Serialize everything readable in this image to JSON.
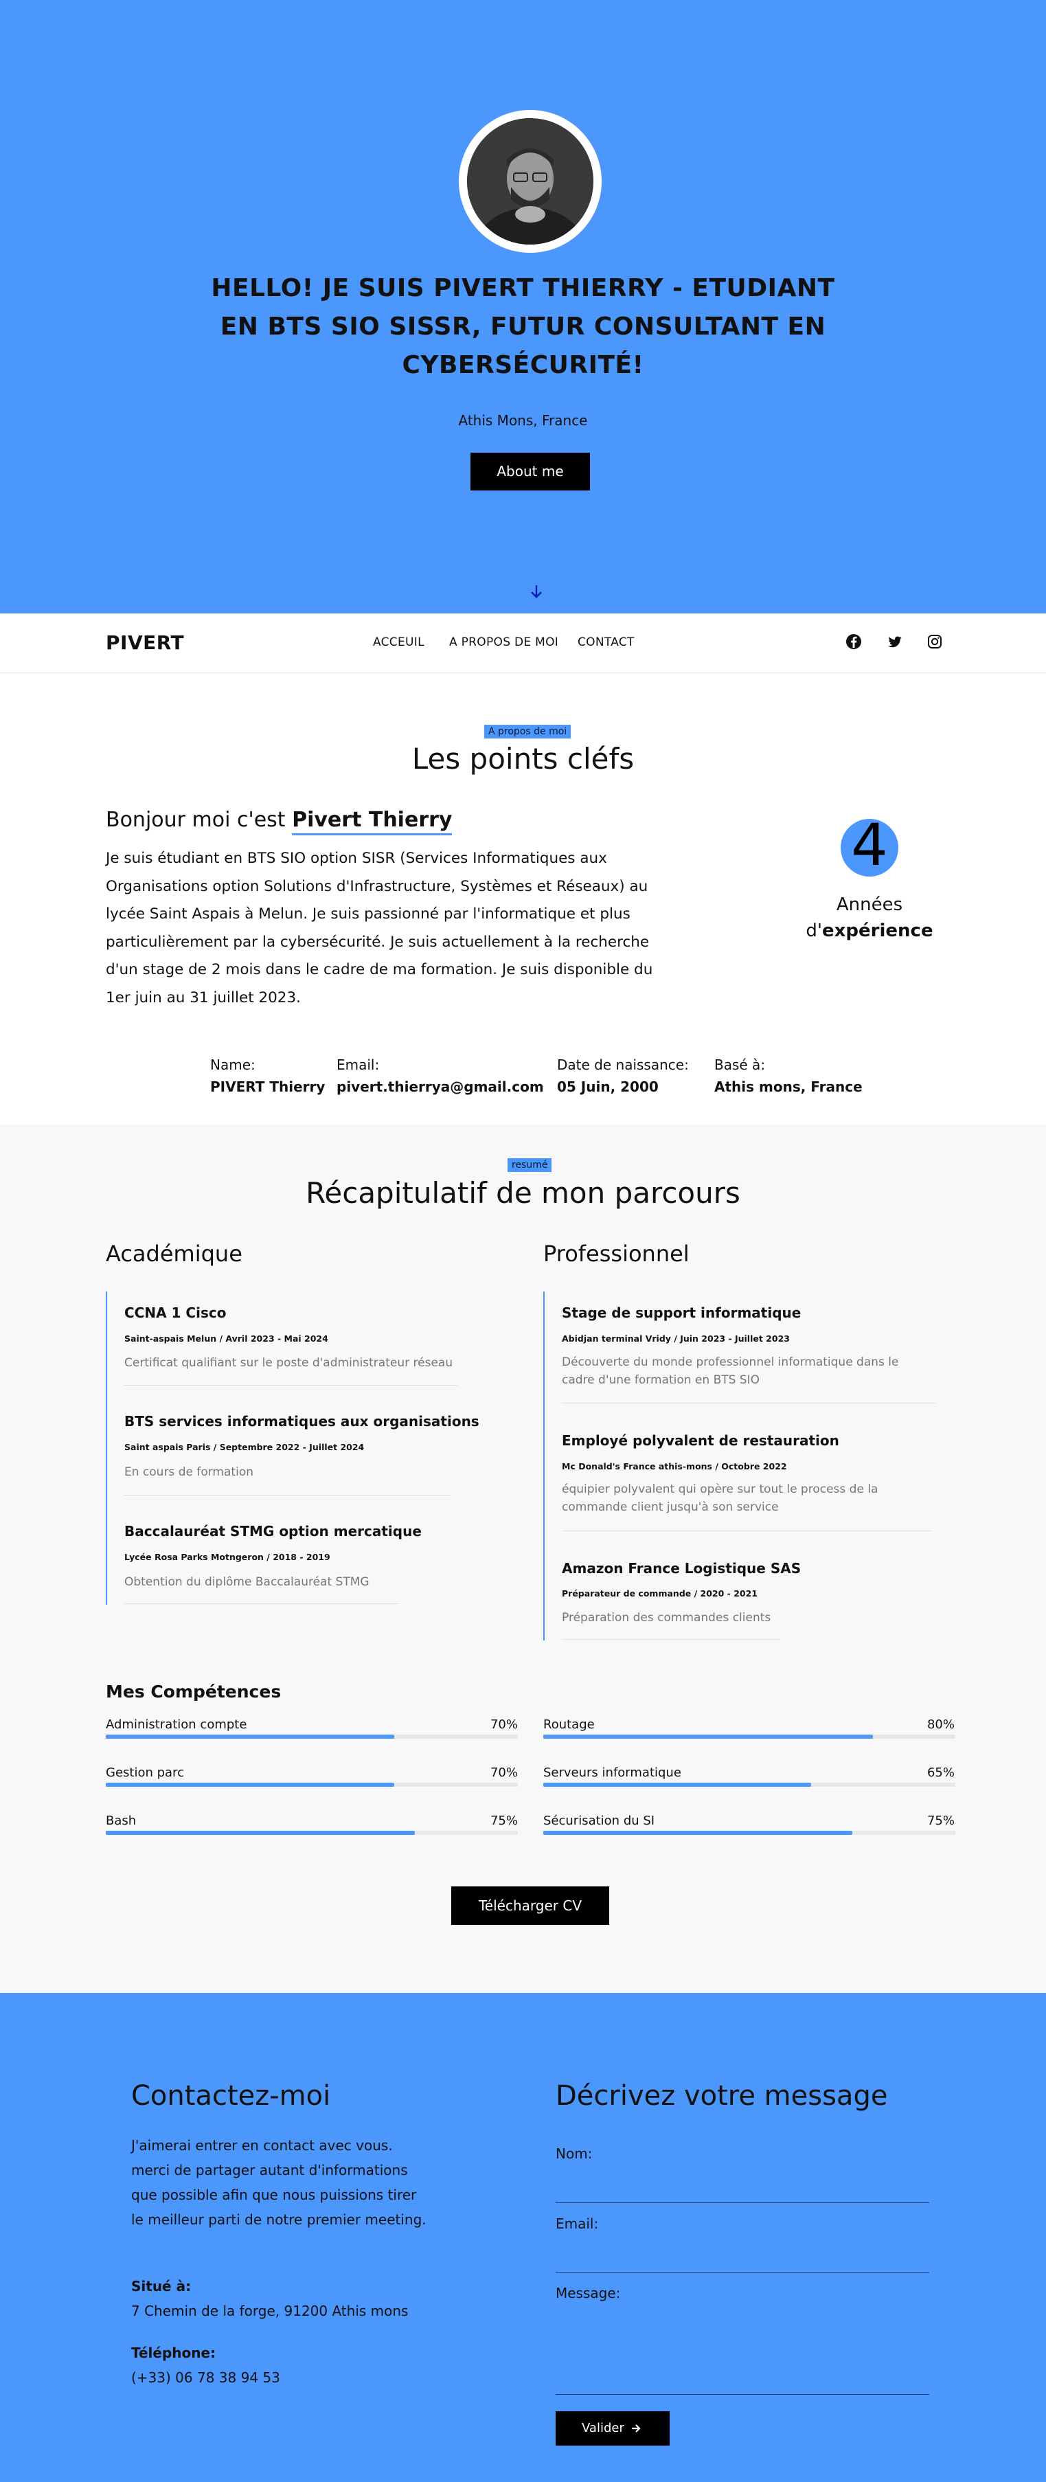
{
  "colors": {
    "accent": "#4b97fb",
    "button": "#000000"
  },
  "hero": {
    "title": "HELLO! JE SUIS PIVERT THIERRY - ETUDIANT EN BTS SIO SISSR, FUTUR CONSULTANT EN CYBERSÉCURITÉ!",
    "location": "Athis Mons, France",
    "about_button": "About me",
    "scroll_icon": "arrow-down-icon"
  },
  "nav": {
    "brand": "PIVERT",
    "links": [
      "ACCEUIL",
      "A PROPOS DE MOI",
      "CONTACT"
    ],
    "social_icons": [
      "facebook-icon",
      "twitter-icon",
      "instagram-icon"
    ]
  },
  "about": {
    "tag": "A propos de moi",
    "title": "Les points cléfs",
    "hello_prefix": "Bonjour moi c'est ",
    "hello_name": "Pivert Thierry",
    "paragraph": "Je suis étudiant en BTS SIO option SISR (Services Informatiques aux Organisations option Solutions d'Infrastructure, Systèmes et Réseaux) au lycée Saint Aspais à Melun. Je suis passionné par l'informatique et plus particulièrement par la cybersécurité. Je suis actuellement à la recherche d'un stage de 2 mois dans le cadre de ma formation. Je suis disponible du 1er juin au 31 juillet 2023.",
    "years_number": "4",
    "years_label": "Années",
    "years_label2_prefix": "d'",
    "years_label2_bold": "expérience",
    "info": [
      {
        "label": "Name:",
        "value": "PIVERT Thierry"
      },
      {
        "label": "Email:",
        "value": "pivert.thierrya@gmail.com"
      },
      {
        "label": "Date de naissance:",
        "value": "05 Juin, 2000"
      },
      {
        "label": "Basé à:",
        "value": "Athis mons, France"
      }
    ]
  },
  "resume": {
    "tag": "resumé",
    "title": "Récapitulatif de mon parcours",
    "academic_title": "Académique",
    "professional_title": "Professionnel",
    "academic": [
      {
        "title": "CCNA 1 Cisco",
        "meta": "Saint-aspais Melun / Avril 2023 - Mai 2024",
        "desc": "Certificat qualifiant sur le poste d'administrateur réseau"
      },
      {
        "title": "BTS services informatiques aux organisations",
        "meta": "Saint aspais Paris / Septembre 2022 - Juillet 2024",
        "desc": "En cours de formation"
      },
      {
        "title": "Baccalauréat STMG option mercatique",
        "meta": "Lycée Rosa Parks Motngeron / 2018 - 2019",
        "desc": "Obtention du diplôme Baccalauréat STMG"
      }
    ],
    "professional": [
      {
        "title": "Stage de support informatique",
        "meta": "Abidjan terminal Vridy / Juin 2023 - Juillet 2023",
        "desc": "Découverte du monde professionnel informatique dans le cadre d'une formation en BTS SIO"
      },
      {
        "title": "Employé polyvalent de restauration",
        "meta": "Mc Donald's France athis-mons / Octobre 2022",
        "desc": "équipier polyvalent qui opère sur tout le process de la commande client jusqu'à son service"
      },
      {
        "title": "Amazon France Logistique SAS",
        "meta": "Préparateur de commande / 2020 - 2021",
        "desc": "Préparation des commandes clients"
      }
    ],
    "skills_title": "Mes Compétences",
    "skills": [
      {
        "name": "Administration compte",
        "pct": "70%",
        "value": 0.7
      },
      {
        "name": "Routage",
        "pct": "80%",
        "value": 0.8
      },
      {
        "name": "Gestion parc",
        "pct": "70%",
        "value": 0.7
      },
      {
        "name": "Serveurs informatique",
        "pct": "65%",
        "value": 0.65
      },
      {
        "name": "Bash",
        "pct": "75%",
        "value": 0.75
      },
      {
        "name": "Sécurisation du SI",
        "pct": "75%",
        "value": 0.75
      }
    ],
    "download_button": "Télécharger CV"
  },
  "contact": {
    "title": "Contactez-moi",
    "text": "J'aimerai entrer en contact avec vous. merci de partager autant d'informations que possible afin que nous puissions tirer le meilleur parti de notre premier meeting.",
    "address_label": "Situé à:",
    "address": "7 Chemin de la forge, 91200 Athis mons",
    "phone_label": "Téléphone:",
    "phone": "(+33) 06 78 38 94 53",
    "form_title": "Décrivez votre message",
    "name_label": "Nom:",
    "email_label": "Email:",
    "message_label": "Message:",
    "submit": "Valider"
  }
}
